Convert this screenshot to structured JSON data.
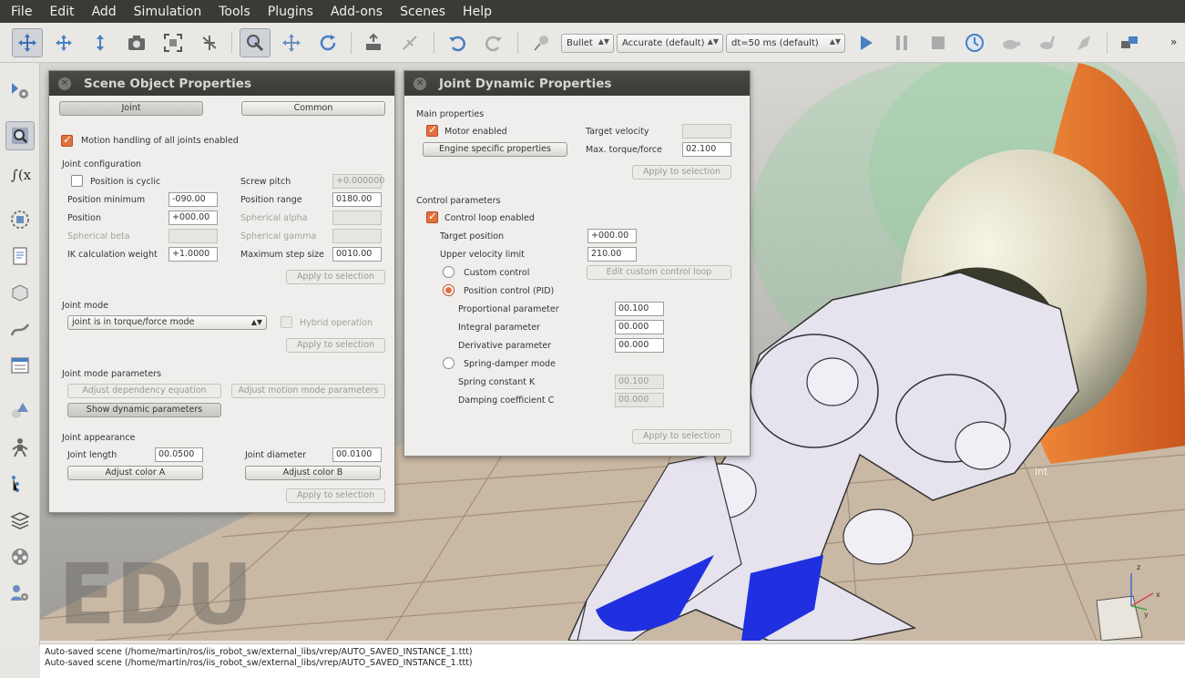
{
  "menubar": {
    "items": [
      "File",
      "Edit",
      "Add",
      "Simulation",
      "Tools",
      "Plugins",
      "Add-ons",
      "Scenes",
      "Help"
    ]
  },
  "toolbar": {
    "engine": "Bullet",
    "accuracy": "Accurate (default)",
    "timestep": "dt=50 ms (default)",
    "more": "»",
    "icons": [
      "camera-pan-icon",
      "camera-rotate-icon",
      "camera-shift-icon",
      "camera-angle-icon",
      "fit-to-view-icon",
      "assemble-icon",
      "object-select-icon",
      "object-shift-icon",
      "object-rotate-icon",
      "hierarchy-icon",
      "undo-icon",
      "redo-icon",
      "start-icon",
      "pause-icon",
      "stop-icon",
      "realtime-icon",
      "slow-down-icon",
      "speed-up-icon",
      "thread-icon",
      "scene-page-icon"
    ]
  },
  "scene_object_panel": {
    "title": "Scene Object Properties",
    "tab_joint": "Joint",
    "tab_common": "Common",
    "motion_handling": "Motion handling of all joints enabled",
    "joint_configuration": "Joint configuration",
    "position_is_cyclic": "Position is cyclic",
    "screw_pitch": "Screw pitch",
    "screw_pitch_value": "+0.000000",
    "position_minimum": "Position minimum",
    "position_minimum_value": "-090.00",
    "position_range": "Position range",
    "position_range_value": "0180.00",
    "position": "Position",
    "position_value": "+000.00",
    "spherical_alpha": "Spherical alpha",
    "spherical_beta": "Spherical beta",
    "spherical_gamma": "Spherical gamma",
    "ik_weight": "IK calculation weight",
    "ik_weight_value": "+1.0000",
    "max_step": "Maximum step size",
    "max_step_value": "0010.00",
    "apply": "Apply to selection",
    "joint_mode": "Joint mode",
    "joint_mode_value": "joint is in torque/force mode",
    "hybrid": "Hybrid operation",
    "joint_mode_params": "Joint mode parameters",
    "adjust_dependency": "Adjust dependency equation",
    "adjust_motion": "Adjust motion mode parameters",
    "show_dynamic": "Show dynamic parameters",
    "joint_appearance": "Joint appearance",
    "joint_length": "Joint length",
    "joint_length_value": "00.0500",
    "joint_diameter": "Joint diameter",
    "joint_diameter_value": "00.0100",
    "color_a": "Adjust color A",
    "color_b": "Adjust color B"
  },
  "joint_dynamic_panel": {
    "title": "Joint Dynamic Properties",
    "main_properties": "Main properties",
    "motor_enabled": "Motor enabled",
    "target_velocity": "Target velocity",
    "engine_specific": "Engine specific properties",
    "max_torque": "Max. torque/force",
    "max_torque_value": "02.100",
    "apply": "Apply to selection",
    "control_parameters": "Control parameters",
    "control_loop": "Control loop enabled",
    "target_position": "Target position",
    "target_position_value": "+000.00",
    "upper_velocity": "Upper velocity limit",
    "upper_velocity_value": "210.00",
    "custom_control": "Custom control",
    "edit_custom": "Edit custom control loop",
    "pid": "Position control (PID)",
    "proportional": "Proportional parameter",
    "proportional_value": "00.100",
    "integral": "Integral parameter",
    "integral_value": "00.000",
    "derivative": "Derivative parameter",
    "derivative_value": "00.000",
    "spring_damper": "Spring-damper mode",
    "spring_k": "Spring constant K",
    "spring_k_value": "00.100",
    "damping_c": "Damping coefficient C",
    "damping_c_value": "00.000"
  },
  "scene": {
    "watermark": "EDU",
    "label": "int",
    "axes": {
      "x": "x",
      "y": "y",
      "z": "z"
    }
  },
  "status": {
    "lines": [
      "Auto-saved scene (/home/martin/ros/iis_robot_sw/external_libs/vrep/AUTO_SAVED_INSTANCE_1.ttt)",
      "Auto-saved scene (/home/martin/ros/iis_robot_sw/external_libs/vrep/AUTO_SAVED_INSTANCE_1.ttt)"
    ]
  },
  "colors": {
    "accent": "#e4703f",
    "title_bar": "#3b3a36",
    "gripper": "#e6e3ee",
    "blue_pad": "#2030e0",
    "orange_link": "#e8702a"
  }
}
